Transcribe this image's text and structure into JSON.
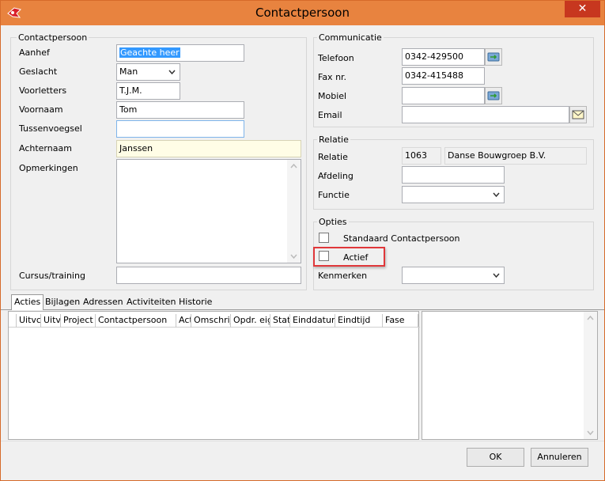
{
  "window": {
    "title": "Contactpersoon",
    "close_symbol": "✕",
    "accent_color": "#e8833f"
  },
  "contact": {
    "group_title": "Contactpersoon",
    "aanhef": {
      "label": "Aanhef",
      "value": "Geachte heer"
    },
    "geslacht": {
      "label": "Geslacht",
      "value": "Man"
    },
    "voorletters": {
      "label": "Voorletters",
      "value": "T.J.M."
    },
    "voornaam": {
      "label": "Voornaam",
      "value": "Tom"
    },
    "tussenvoegsel": {
      "label": "Tussenvoegsel",
      "value": ""
    },
    "achternaam": {
      "label": "Achternaam",
      "value": "Janssen"
    },
    "opmerkingen": {
      "label": "Opmerkingen",
      "value": ""
    },
    "cursus": {
      "label": "Cursus/training",
      "value": ""
    }
  },
  "communicatie": {
    "group_title": "Communicatie",
    "telefoon": {
      "label": "Telefoon",
      "value": "0342-429500"
    },
    "fax": {
      "label": "Fax nr.",
      "value": "0342-415488"
    },
    "mobiel": {
      "label": "Mobiel",
      "value": ""
    },
    "email": {
      "label": "Email",
      "value": ""
    }
  },
  "relatie": {
    "group_title": "Relatie",
    "relatie": {
      "label": "Relatie",
      "code": "1063",
      "name": "Danse Bouwgroep B.V."
    },
    "afdeling": {
      "label": "Afdeling",
      "value": ""
    },
    "functie": {
      "label": "Functie",
      "value": ""
    }
  },
  "opties": {
    "group_title": "Opties",
    "standaard": {
      "label": "Standaard Contactpersoon",
      "checked": false
    },
    "actief": {
      "label": "Actief",
      "checked": false
    },
    "kenmerken": {
      "label": "Kenmerken",
      "value": ""
    }
  },
  "tabs": [
    {
      "label": "Acties",
      "active": true
    },
    {
      "label": "Bijlagen"
    },
    {
      "label": "Adressen"
    },
    {
      "label": "Activiteiten Historie"
    }
  ],
  "grid": {
    "columns": [
      "Uitvc",
      "Uitvi",
      "Project",
      "Contactpersoon",
      "Act",
      "Omschrijv",
      "Opdr. eig",
      "Stati",
      "Einddatum",
      "Eindtijd",
      "Fase"
    ]
  },
  "footer": {
    "ok_label": "OK",
    "cancel_label": "Annuleren"
  }
}
